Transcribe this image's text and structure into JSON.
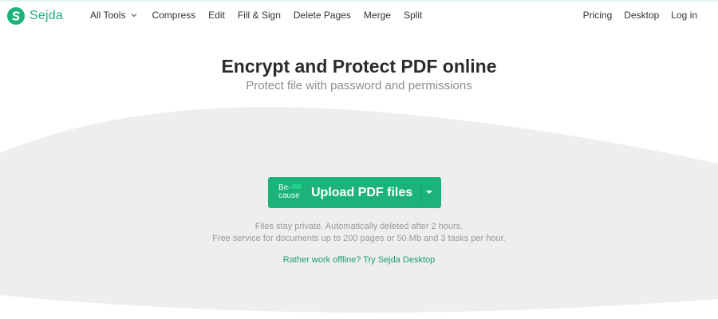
{
  "brand": {
    "name": "Sejda",
    "color": "#1cb37a"
  },
  "nav": {
    "left": [
      "All Tools",
      "Compress",
      "Edit",
      "Fill & Sign",
      "Delete Pages",
      "Merge",
      "Split"
    ],
    "right": [
      "Pricing",
      "Desktop",
      "Log in"
    ]
  },
  "hero": {
    "title": "Encrypt and Protect PDF online",
    "subtitle": "Protect file with password and permissions"
  },
  "upload": {
    "icon_text_line1": "Be-",
    "icon_text_line2": "cause",
    "label": "Upload PDF files"
  },
  "info": {
    "line1": "Files stay private. Automatically deleted after 2 hours.",
    "line2": "Free service for documents up to 200 pages or 50 Mb and 3 tasks per hour."
  },
  "offline_link": "Rather work offline? Try Sejda Desktop",
  "colors": {
    "accent": "#1cb37a",
    "wave": "#eeeeee",
    "link": "#1c9e6b"
  }
}
